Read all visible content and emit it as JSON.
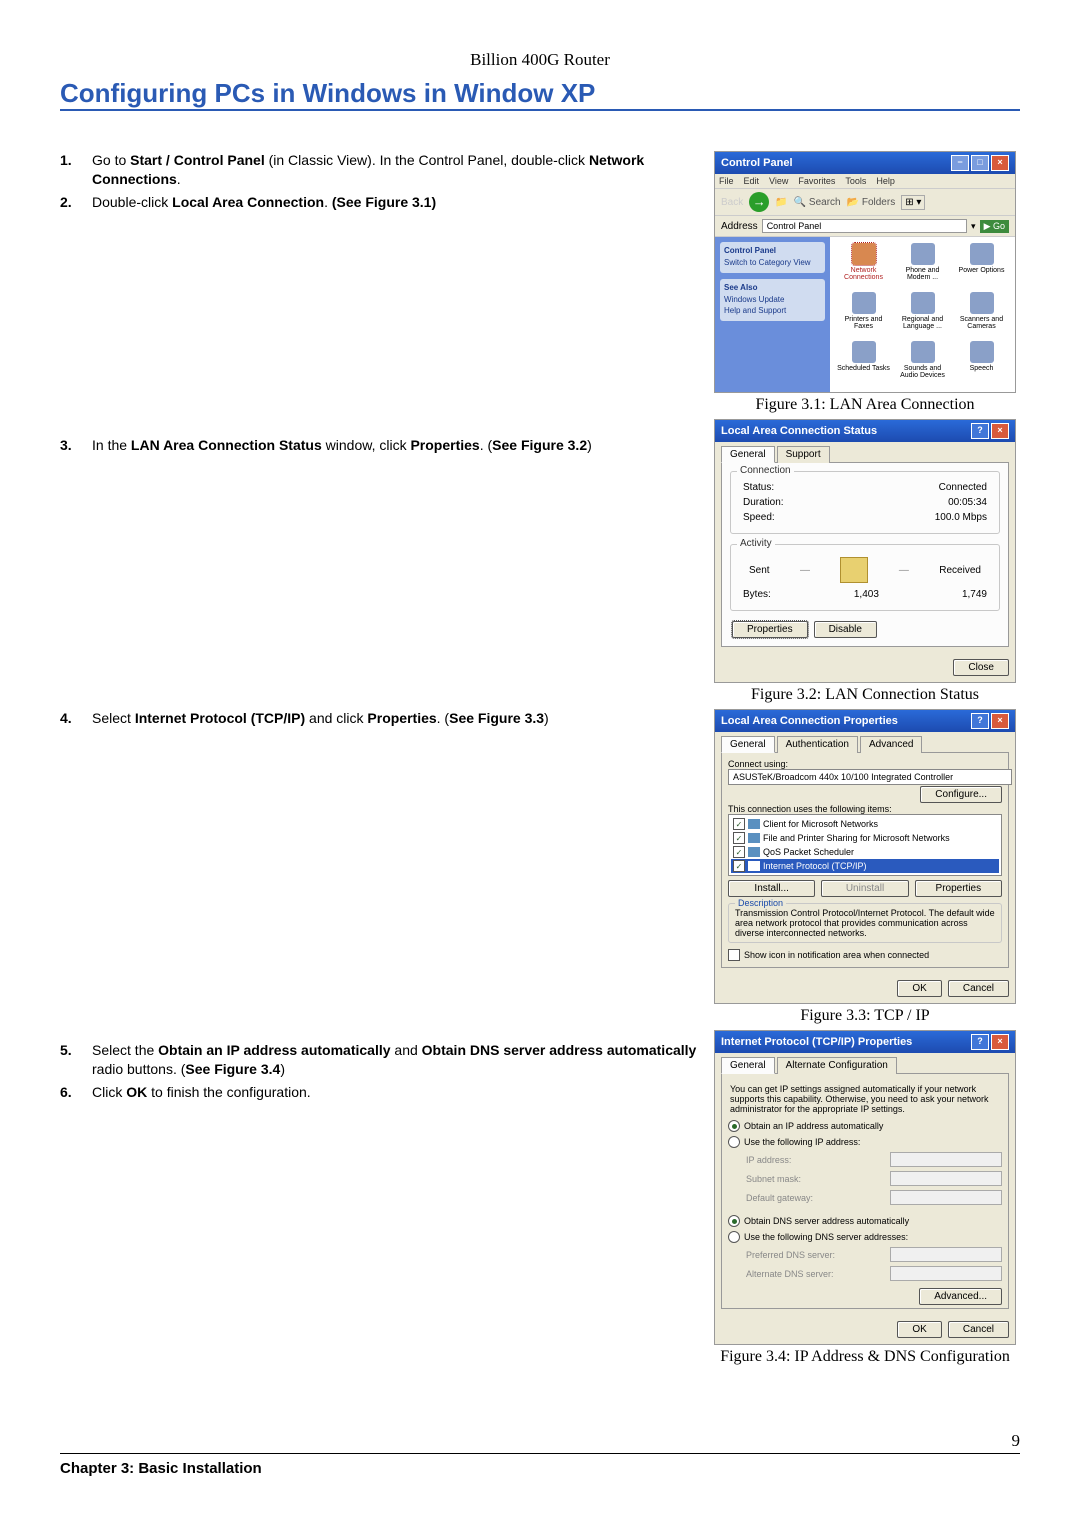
{
  "header": "Billion 400G Router",
  "title": "Configuring PCs in Windows in Window XP",
  "steps": {
    "s1": {
      "n": "1.",
      "html": "Go to <b>Start / Control Panel</b> (in Classic View). In the Control Panel, double-click <b>Network Connections</b>."
    },
    "s2": {
      "n": "2.",
      "html": "Double-click <b>Local Area Connection</b>. <b>(See Figure 3.1)</b>"
    },
    "s3": {
      "n": "3.",
      "html": "In the <b>LAN Area Connection Status</b> window, click <b>Properties</b>. (<b>See Figure 3.2</b>)"
    },
    "s4": {
      "n": "4.",
      "html": "Select <b>Internet Protocol (TCP/IP)</b> and click <b>Properties</b>. (<b>See Figure 3.3</b>)"
    },
    "s5": {
      "n": "5.",
      "html": "Select the <b>Obtain an IP address automatically</b> and <b>Obtain DNS server address automatically</b> radio buttons. (<b>See Figure 3.4</b>)"
    },
    "s6": {
      "n": "6.",
      "html": "Click <b>OK</b> to finish the configuration."
    }
  },
  "fig1": {
    "caption": "Figure 3.1: LAN Area Connection",
    "winTitle": "Control Panel",
    "menu": {
      "file": "File",
      "edit": "Edit",
      "view": "View",
      "fav": "Favorites",
      "tools": "Tools",
      "help": "Help"
    },
    "toolbar": {
      "back": "Back",
      "search": "Search",
      "folders": "Folders"
    },
    "addressLbl": "Address",
    "addressVal": "Control Panel",
    "go": "Go",
    "sidebar": {
      "cpTitle": "Control Panel",
      "switch": "Switch to Category View",
      "seeAlso": "See Also",
      "winUpdate": "Windows Update",
      "help": "Help and Support"
    },
    "icons": {
      "net": "Network Connections",
      "phone": "Phone and Modem ...",
      "power": "Power Options",
      "printers": "Printers and Faxes",
      "region": "Regional and Language ...",
      "scanners": "Scanners and Cameras",
      "tasks": "Scheduled Tasks",
      "sounds": "Sounds and Audio Devices",
      "speech": "Speech"
    }
  },
  "fig2": {
    "caption": "Figure 3.2: LAN Connection Status",
    "winTitle": "Local Area Connection Status",
    "tabs": {
      "general": "General",
      "support": "Support"
    },
    "connGroup": "Connection",
    "statusLbl": "Status:",
    "statusVal": "Connected",
    "durLbl": "Duration:",
    "durVal": "00:05:34",
    "speedLbl": "Speed:",
    "speedVal": "100.0 Mbps",
    "actGroup": "Activity",
    "sent": "Sent",
    "received": "Received",
    "bytesLbl": "Bytes:",
    "bytesSent": "1,403",
    "bytesRecv": "1,749",
    "properties": "Properties",
    "disable": "Disable",
    "close": "Close"
  },
  "fig3": {
    "caption": "Figure 3.3: TCP / IP",
    "winTitle": "Local Area Connection Properties",
    "tabs": {
      "general": "General",
      "auth": "Authentication",
      "advanced": "Advanced"
    },
    "connectUsing": "Connect using:",
    "adapter": "ASUSTeK/Broadcom 440x 10/100 Integrated Controller",
    "configure": "Configure...",
    "usesItems": "This connection uses the following items:",
    "items": {
      "cms": "Client for Microsoft Networks",
      "fps": "File and Printer Sharing for Microsoft Networks",
      "qos": "QoS Packet Scheduler",
      "tcpip": "Internet Protocol (TCP/IP)"
    },
    "install": "Install...",
    "uninstall": "Uninstall",
    "properties": "Properties",
    "descTitle": "Description",
    "desc": "Transmission Control Protocol/Internet Protocol. The default wide area network protocol that provides communication across diverse interconnected networks.",
    "showIcon": "Show icon in notification area when connected",
    "ok": "OK",
    "cancel": "Cancel"
  },
  "fig4": {
    "caption": "Figure 3.4: IP Address & DNS Configuration",
    "winTitle": "Internet Protocol (TCP/IP) Properties",
    "tabs": {
      "general": "General",
      "alt": "Alternate Configuration"
    },
    "note": "You can get IP settings assigned automatically if your network supports this capability. Otherwise, you need to ask your network administrator for the appropriate IP settings.",
    "obtainIp": "Obtain an IP address automatically",
    "useIp": "Use the following IP address:",
    "ipAddr": "IP address:",
    "subnet": "Subnet mask:",
    "gateway": "Default gateway:",
    "obtainDns": "Obtain DNS server address automatically",
    "useDns": "Use the following DNS server addresses:",
    "prefDns": "Preferred DNS server:",
    "altDns": "Alternate DNS server:",
    "advanced": "Advanced...",
    "ok": "OK",
    "cancel": "Cancel"
  },
  "pageNum": "9",
  "chapter": "Chapter 3: Basic Installation"
}
